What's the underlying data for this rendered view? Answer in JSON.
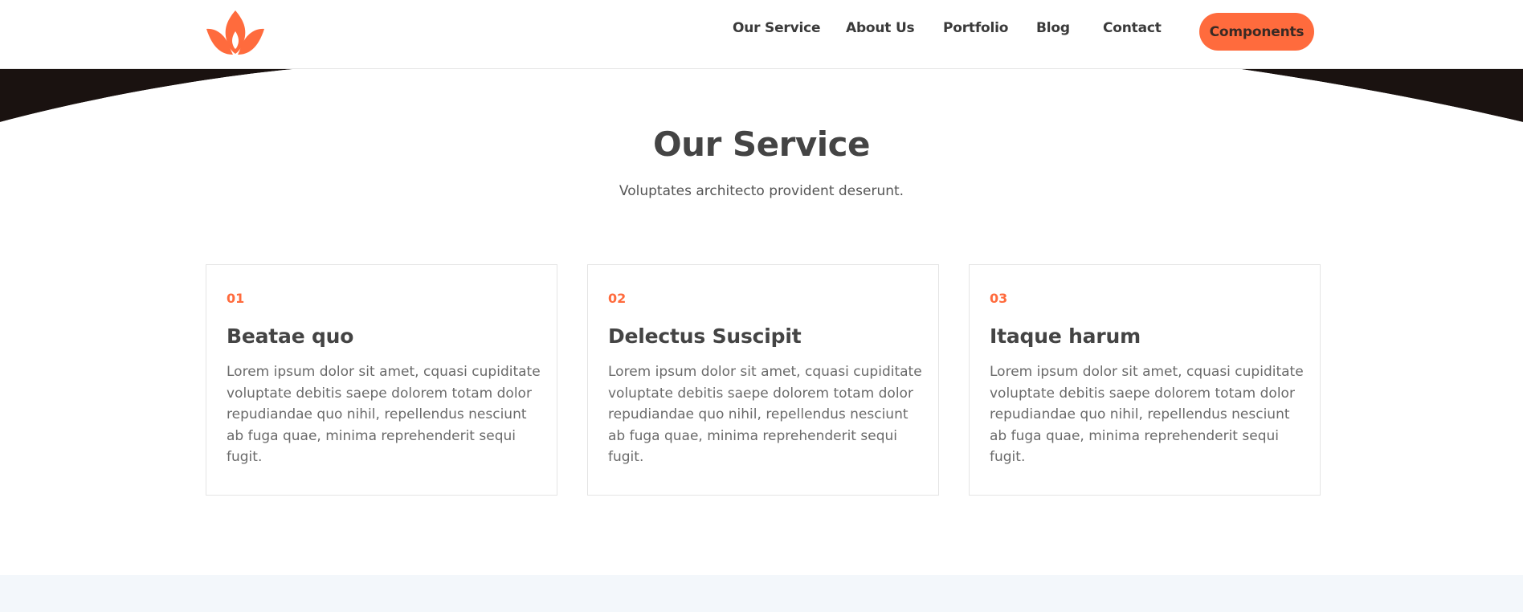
{
  "colors": {
    "accent": "#ff6b3d",
    "heading": "#444444",
    "dark_band": "#1a1210",
    "footer_band": "#f3f7fb"
  },
  "header": {
    "logo_icon": "lotus-flame-logo",
    "nav": [
      {
        "label": "Our Service"
      },
      {
        "label": "About Us"
      },
      {
        "label": "Portfolio"
      },
      {
        "label": "Blog"
      },
      {
        "label": "Contact"
      }
    ],
    "cta_label": "Components"
  },
  "section": {
    "title": "Our Service",
    "subtitle": "Voluptates architecto provident deserunt."
  },
  "cards": [
    {
      "number": "01",
      "title": "Beatae quo",
      "text": "Lorem ipsum dolor sit amet, cquasi cupiditate voluptate debitis saepe dolorem totam dolor repudiandae quo nihil, repellendus nesciunt ab fuga quae, minima reprehenderit sequi fugit."
    },
    {
      "number": "02",
      "title": "Delectus Suscipit",
      "text": "Lorem ipsum dolor sit amet, cquasi cupiditate voluptate debitis saepe dolorem totam dolor repudiandae quo nihil, repellendus nesciunt ab fuga quae, minima reprehenderit sequi fugit."
    },
    {
      "number": "03",
      "title": "Itaque harum",
      "text": "Lorem ipsum dolor sit amet, cquasi cupiditate voluptate debitis saepe dolorem totam dolor repudiandae quo nihil, repellendus nesciunt ab fuga quae, minima reprehenderit sequi fugit."
    }
  ]
}
